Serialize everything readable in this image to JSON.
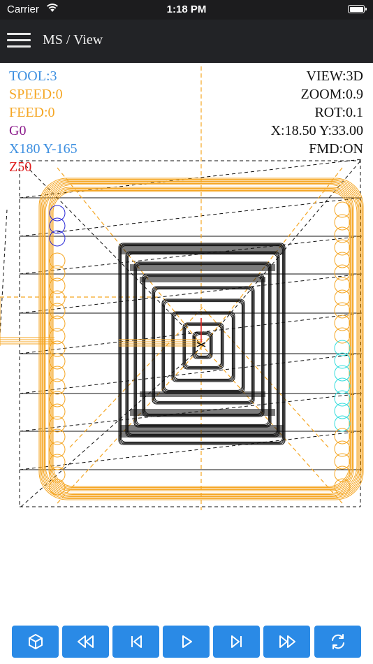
{
  "status_bar": {
    "carrier": "Carrier",
    "time": "1:18 PM"
  },
  "nav": {
    "title": "MS / View",
    "menu_icon": "hamburger-menu-icon"
  },
  "hud_left": {
    "tool": "TOOL:3",
    "speed": "SPEED:0",
    "feed": "FEED:0",
    "gcode": "G0",
    "xy": "X180 Y-165",
    "z": "Z50"
  },
  "hud_right": {
    "view": "VIEW:3D",
    "zoom": "ZOOM:0.9",
    "rot": "ROT:0.1",
    "coords": "X:18.50 Y:33.00",
    "fmd": "FMD:ON"
  },
  "colors": {
    "tool": "#3d8fe0",
    "speed": "#f5a623",
    "feed": "#f5a623",
    "gcode": "#8b1a8b",
    "xy": "#3d8fe0",
    "z": "#e02020",
    "toolpath_orange": "#f5a623",
    "toolpath_black": "#111111",
    "toolpath_blue": "#2a2ad8",
    "toolpath_cyan": "#33dddd",
    "button": "#2a8ae6"
  },
  "toolbar": {
    "buttons": [
      {
        "name": "3d-view-button",
        "icon": "cube-icon"
      },
      {
        "name": "rewind-button",
        "icon": "rewind-icon"
      },
      {
        "name": "skip-back-button",
        "icon": "skip-back-icon"
      },
      {
        "name": "play-button",
        "icon": "play-icon"
      },
      {
        "name": "skip-forward-button",
        "icon": "skip-forward-icon"
      },
      {
        "name": "fast-forward-button",
        "icon": "fast-forward-icon"
      },
      {
        "name": "refresh-button",
        "icon": "refresh-icon"
      }
    ]
  }
}
